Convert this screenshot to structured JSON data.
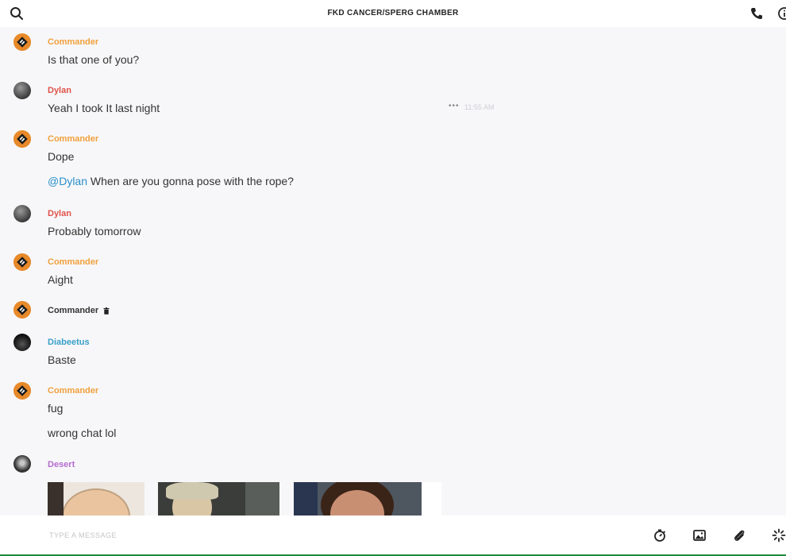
{
  "header": {
    "title": "FKD CANCER/SPERG CHAMBER"
  },
  "messages": [
    {
      "author": "Commander",
      "lines": [
        "Is that one of you?"
      ]
    },
    {
      "author": "Dylan",
      "lines": [
        "Yeah I took It last night"
      ],
      "time": "11:55 AM",
      "more": "•••"
    },
    {
      "author": "Commander",
      "lines": [
        "Dope"
      ],
      "mention": "@Dylan",
      "mention_text": " When are you gonna pose with the rope?"
    },
    {
      "author": "Dylan",
      "lines": [
        "Probably tomorrow"
      ]
    },
    {
      "author": "Commander",
      "lines": [
        "Aight"
      ]
    },
    {
      "author": "Commander",
      "lines": []
    },
    {
      "author": "Diabeetus",
      "lines": [
        "Baste"
      ]
    },
    {
      "author": "Commander",
      "lines": [
        "fug",
        "wrong chat lol"
      ]
    },
    {
      "author": "Desert",
      "lines": []
    }
  ],
  "composer": {
    "placeholder": "TYPE A MESSAGE"
  },
  "icons": [
    "search-icon",
    "phone-icon",
    "info-icon",
    "timer-icon",
    "image-icon",
    "paperclip-icon",
    "sparkle-icon",
    "trash-icon"
  ],
  "colors": {
    "commander": "#f0a03c",
    "dylan": "#e0524a",
    "diabeetus": "#3aa0c8",
    "desert": "#b66dd1",
    "mention": "#2a8fc8"
  }
}
